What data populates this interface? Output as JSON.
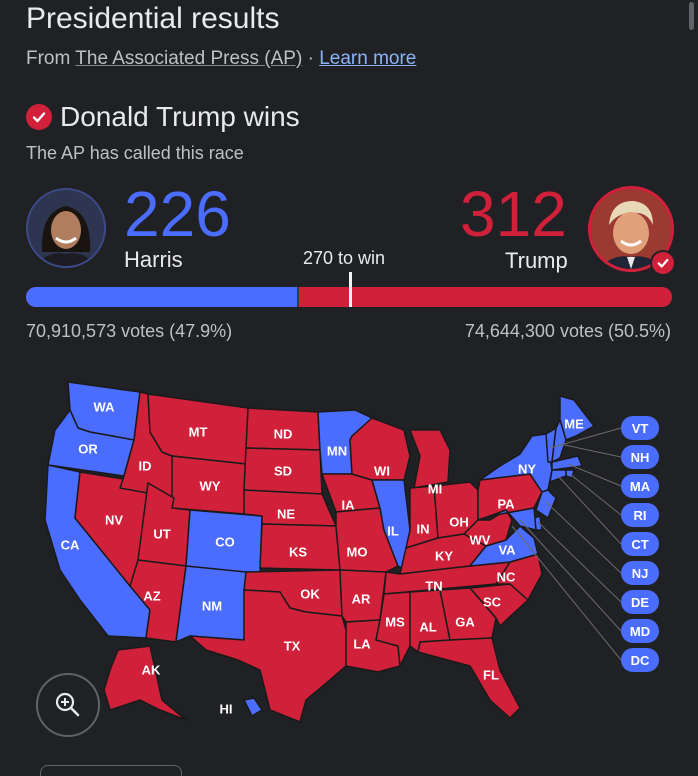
{
  "header": {
    "title": "Presidential results",
    "source_prefix": "From",
    "source_link": "The Associated Press (AP)",
    "separator": "·",
    "learn_more": "Learn more"
  },
  "result": {
    "winner_text": "Donald Trump wins",
    "called_text": "The AP has called this race"
  },
  "colors": {
    "dem": "#4a6cff",
    "rep": "#d0203a",
    "background": "#202124",
    "link": "#8ab4f8"
  },
  "candidates": {
    "harris": {
      "name": "Harris",
      "electoral_votes": "226",
      "votes_text": "70,910,573 votes (47.9%)",
      "party": "dem"
    },
    "trump": {
      "name": "Trump",
      "electoral_votes": "312",
      "votes_text": "74,644,300 votes (50.5%)",
      "party": "rep",
      "winner": true
    }
  },
  "progress": {
    "threshold_label": "270 to win",
    "total_electoral_votes": 538,
    "dem_ev": 226,
    "rep_ev": 312,
    "threshold": 270
  },
  "map": {
    "states": {
      "WA": "dem",
      "OR": "dem",
      "CA": "dem",
      "NV": "rep",
      "ID": "rep",
      "MT": "rep",
      "WY": "rep",
      "UT": "rep",
      "AZ": "rep",
      "CO": "dem",
      "NM": "dem",
      "ND": "rep",
      "SD": "rep",
      "NE": "rep",
      "KS": "rep",
      "OK": "rep",
      "TX": "rep",
      "MN": "dem",
      "IA": "rep",
      "MO": "rep",
      "AR": "rep",
      "LA": "rep",
      "WI": "rep",
      "IL": "dem",
      "MI": "rep",
      "IN": "rep",
      "OH": "rep",
      "KY": "rep",
      "TN": "rep",
      "MS": "rep",
      "AL": "rep",
      "GA": "rep",
      "FL": "rep",
      "SC": "rep",
      "NC": "rep",
      "VA": "dem",
      "WV": "rep",
      "PA": "rep",
      "NY": "dem",
      "ME": "dem",
      "AK": "rep",
      "HI": "dem"
    },
    "small_states": [
      "VT",
      "NH",
      "MA",
      "RI",
      "CT",
      "NJ",
      "DE",
      "MD",
      "DC"
    ],
    "zoom_button": "zoom-in"
  }
}
